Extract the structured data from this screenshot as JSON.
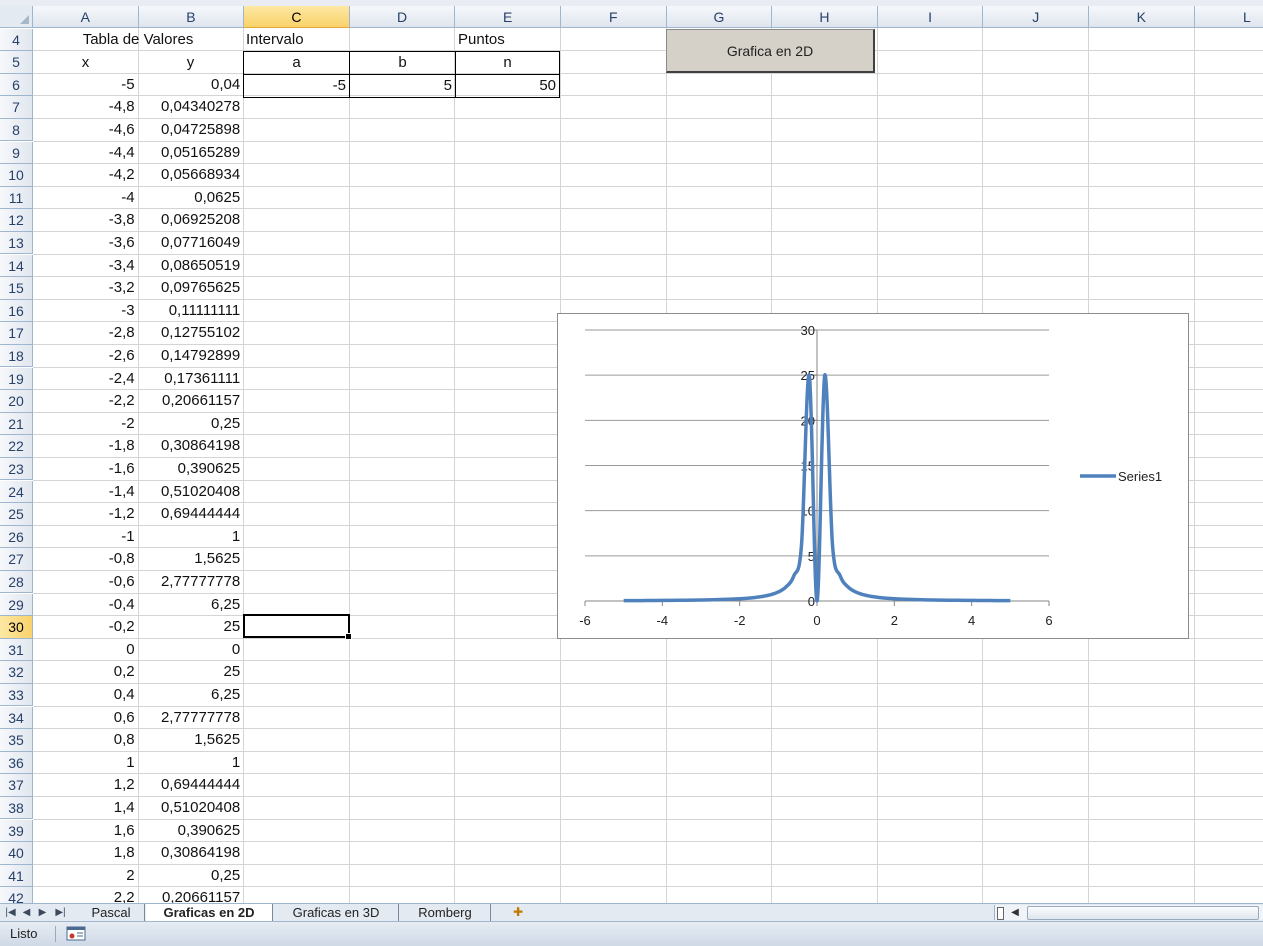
{
  "columns": [
    "A",
    "B",
    "C",
    "D",
    "E",
    "F",
    "G",
    "H",
    "I",
    "J",
    "K",
    "L"
  ],
  "selected_column": "C",
  "selected_row": "30",
  "rows": [
    "4",
    "5",
    "6",
    "7",
    "8",
    "9",
    "10",
    "11",
    "12",
    "13",
    "14",
    "15",
    "16",
    "17",
    "18",
    "19",
    "20",
    "21",
    "22",
    "23",
    "24",
    "25",
    "26",
    "27",
    "28",
    "29",
    "30",
    "31",
    "32",
    "33",
    "34",
    "35",
    "36",
    "37",
    "38",
    "39",
    "40",
    "41",
    "42"
  ],
  "header_cells": {
    "table_title": "Tabla de Valores",
    "x_header": "x",
    "y_header": "y",
    "interval_label": "Intervalo",
    "points_label": "Puntos",
    "a_label": "a",
    "b_label": "b",
    "n_label": "n",
    "a_value": "-5",
    "b_value": "5",
    "n_value": "50"
  },
  "table": {
    "x": [
      "-5",
      "-4,8",
      "-4,6",
      "-4,4",
      "-4,2",
      "-4",
      "-3,8",
      "-3,6",
      "-3,4",
      "-3,2",
      "-3",
      "-2,8",
      "-2,6",
      "-2,4",
      "-2,2",
      "-2",
      "-1,8",
      "-1,6",
      "-1,4",
      "-1,2",
      "-1",
      "-0,8",
      "-0,6",
      "-0,4",
      "-0,2",
      "0",
      "0,2",
      "0,4",
      "0,6",
      "0,8",
      "1",
      "1,2",
      "1,4",
      "1,6",
      "1,8",
      "2",
      "2,2"
    ],
    "y": [
      "0,04",
      "0,04340278",
      "0,04725898",
      "0,05165289",
      "0,05668934",
      "0,0625",
      "0,06925208",
      "0,07716049",
      "0,08650519",
      "0,09765625",
      "0,11111111",
      "0,12755102",
      "0,14792899",
      "0,17361111",
      "0,20661157",
      "0,25",
      "0,30864198",
      "0,390625",
      "0,51020408",
      "0,69444444",
      "1",
      "1,5625",
      "2,77777778",
      "6,25",
      "25",
      "0",
      "25",
      "6,25",
      "2,77777778",
      "1,5625",
      "1",
      "0,69444444",
      "0,51020408",
      "0,390625",
      "0,30864198",
      "0,25",
      "0,20661157"
    ]
  },
  "macro_button": {
    "label": "Grafica en 2D"
  },
  "chart_data": {
    "type": "line",
    "x_ticks": [
      "-6",
      "-4",
      "-2",
      "0",
      "2",
      "4",
      "6"
    ],
    "y_ticks": [
      "0",
      "5",
      "10",
      "15",
      "20",
      "25",
      "30"
    ],
    "xlim": [
      -6,
      6
    ],
    "ylim": [
      0,
      30
    ],
    "grid": "horizontal",
    "legend_position": "right",
    "series": [
      {
        "name": "Series1",
        "color": "#4f81bd",
        "x": [
          -5,
          -4.8,
          -4.6,
          -4.4,
          -4.2,
          -4,
          -3.8,
          -3.6,
          -3.4,
          -3.2,
          -3,
          -2.8,
          -2.6,
          -2.4,
          -2.2,
          -2,
          -1.8,
          -1.6,
          -1.4,
          -1.2,
          -1,
          -0.8,
          -0.6,
          -0.4,
          -0.2,
          0,
          0.2,
          0.4,
          0.6,
          0.8,
          1,
          1.2,
          1.4,
          1.6,
          1.8,
          2,
          2.2,
          2.4,
          2.6,
          2.8,
          3,
          3.2,
          3.4,
          3.6,
          3.8,
          4,
          4.2,
          4.4,
          4.6,
          4.8,
          5
        ],
        "y": [
          0.04,
          0.04340278,
          0.04725898,
          0.05165289,
          0.05668934,
          0.0625,
          0.06925208,
          0.07716049,
          0.08650519,
          0.09765625,
          0.11111111,
          0.12755102,
          0.14792899,
          0.17361111,
          0.20661157,
          0.25,
          0.30864198,
          0.390625,
          0.51020408,
          0.69444444,
          1,
          1.5625,
          2.77777778,
          6.25,
          25,
          0,
          25,
          6.25,
          2.77777778,
          1.5625,
          1,
          0.69444444,
          0.51020408,
          0.390625,
          0.30864198,
          0.25,
          0.20661157,
          0.17361111,
          0.14792899,
          0.12755102,
          0.11111111,
          0.09765625,
          0.08650519,
          0.07716049,
          0.06925208,
          0.0625,
          0.05668934,
          0.05165289,
          0.04725898,
          0.04340278,
          0.04
        ]
      }
    ]
  },
  "sheet_tabs": [
    "Pascal",
    "Graficas en 2D",
    "Graficas en 3D",
    "Romberg"
  ],
  "active_tab": 1,
  "status": {
    "ready": "Listo"
  },
  "icons": {
    "nav_first": "first-sheet-icon",
    "nav_prev": "prev-sheet-icon",
    "nav_next": "next-sheet-icon",
    "nav_last": "last-sheet-icon",
    "insert_sheet": "insert-sheet-icon",
    "macro_record": "macro-record-icon"
  }
}
